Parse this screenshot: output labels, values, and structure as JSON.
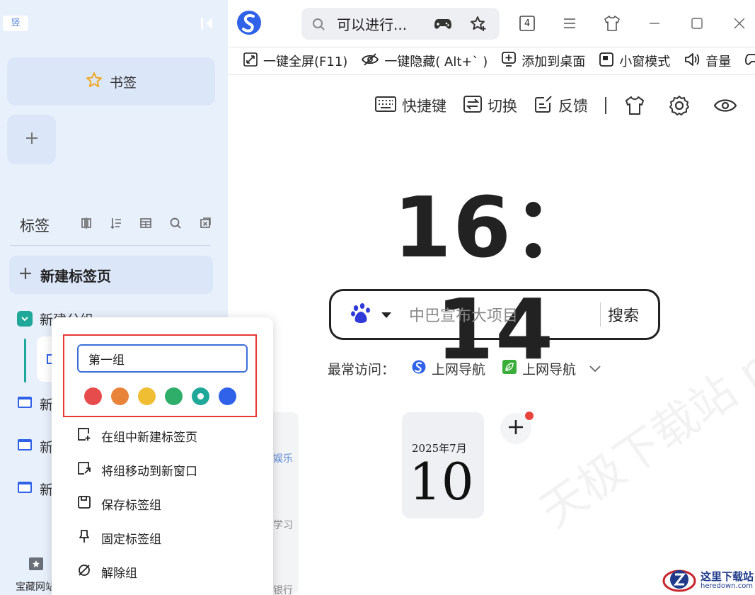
{
  "sidebar": {
    "logo_text": "竖",
    "bookmark_label": "书签",
    "tabs_label": "标签",
    "new_tab_label": "新建标签页",
    "group_name": "新建分组",
    "tab_items": [
      "新",
      "新",
      "新"
    ],
    "footer_label": "宝藏网站"
  },
  "topbar": {
    "address_text": "可以进行...",
    "tab_count": "4",
    "toolbar_items": [
      "一键全屏(F11)",
      "一键隐藏( Alt+` )",
      "添加到桌面",
      "小窗模式",
      "音量"
    ]
  },
  "main": {
    "quick_links": [
      "快捷键",
      "切换",
      "反馈"
    ],
    "clock": "16：14",
    "search_placeholder": "中巴宣布大项目",
    "search_button": "搜索",
    "frequent_label": "最常访问：",
    "frequent_items": [
      "上网导航",
      "上网导航"
    ],
    "widget_texts": [
      "娱乐",
      "学习",
      "银行"
    ],
    "calendar_month": "2025年7月",
    "calendar_day": "10",
    "watermark": "天极下载站 mydown.yesky.com",
    "site_badge_title": "这里下载站",
    "site_badge_url": "heredown.com"
  },
  "context_menu": {
    "name_value": "第一组",
    "colors": [
      "#e74c4c",
      "#e8833a",
      "#f0be32",
      "#2fae6a",
      "#1fa89a",
      "#2f62e8"
    ],
    "selected_color_index": 4,
    "items": [
      "在组中新建标签页",
      "将组移动到新窗口",
      "保存标签组",
      "固定标签组",
      "解除组"
    ]
  },
  "colors": {
    "sidebar_bg": "#e8f0fc",
    "accent_teal": "#1fa89a",
    "highlight_red": "#e53935",
    "input_border": "#3a6fd8"
  },
  "icons": {
    "sidebar_tools": [
      "split-vertical-icon",
      "list-tree-icon",
      "table-icon",
      "search-icon",
      "close-all-icon"
    ],
    "window_controls": [
      "minimize-icon",
      "maximize-icon",
      "close-icon"
    ]
  }
}
